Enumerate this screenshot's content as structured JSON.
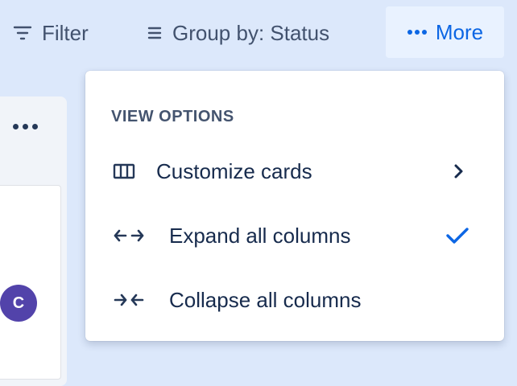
{
  "toolbar": {
    "filter_label": "Filter",
    "group_label": "Group by: Status",
    "more_label": "More"
  },
  "column": {
    "avatar_initial": "C"
  },
  "menu": {
    "heading": "VIEW OPTIONS",
    "items": [
      {
        "label": "Customize cards",
        "icon": "columns-icon",
        "trailing": "chevron-right-icon"
      },
      {
        "label": "Expand all columns",
        "icon": "expand-arrows-icon",
        "trailing": "checkmark-icon",
        "selected": true
      },
      {
        "label": "Collapse all columns",
        "icon": "collapse-arrows-icon",
        "trailing": null
      }
    ]
  },
  "colors": {
    "background": "#dce8fb",
    "accent": "#0c66e4",
    "avatar": "#5243aa"
  }
}
